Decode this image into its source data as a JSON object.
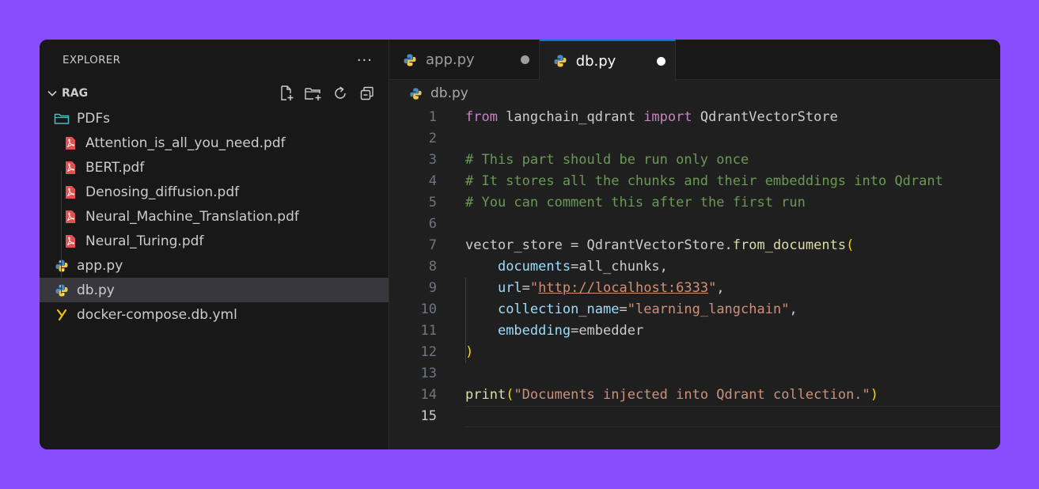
{
  "explorer": {
    "title": "EXPLORER",
    "more": "···",
    "section_title": "RAG",
    "actions": [
      "new-file-icon",
      "new-folder-icon",
      "refresh-icon",
      "collapse-all-icon"
    ],
    "folder": {
      "label": "PDFs",
      "icon": "folder-icon"
    },
    "pdf_files": [
      "Attention_is_all_you_need.pdf",
      "BERT.pdf",
      "Denosing_diffusion.pdf",
      "Neural_Machine_Translation.pdf",
      "Neural_Turing.pdf"
    ],
    "root_files": [
      {
        "label": "app.py",
        "icon": "python-icon"
      },
      {
        "label": "db.py",
        "icon": "python-icon",
        "selected": true
      },
      {
        "label": "docker-compose.db.yml",
        "icon": "yaml-icon"
      }
    ]
  },
  "tabs": [
    {
      "label": "app.py",
      "active": false,
      "unsaved": true
    },
    {
      "label": "db.py",
      "active": true,
      "unsaved": true
    }
  ],
  "breadcrumb": {
    "file": "db.py"
  },
  "colors": {
    "accent": "#0078d4",
    "background": "#8a4dfd",
    "keyword": "#c586c0",
    "comment": "#6a9955",
    "string": "#ce9178",
    "function": "#dcdcaa",
    "parameter": "#9cdcfe",
    "bracket": "#ffd700",
    "pdf_icon": "#e05252",
    "yaml_icon": "#f0c000"
  },
  "code": {
    "current_line": 15,
    "line_numbers": [
      "1",
      "2",
      "3",
      "4",
      "5",
      "6",
      "7",
      "8",
      "9",
      "10",
      "11",
      "12",
      "13",
      "14",
      "15"
    ],
    "l1": {
      "kw1": "from",
      "mod": " langchain_qdrant ",
      "kw2": "import",
      "cls": " QdrantVectorStore"
    },
    "l3": "# This part should be run only once",
    "l4": "# It stores all the chunks and their embeddings into Qdrant",
    "l5": "# You can comment this after the first run",
    "l7": {
      "var": "vector_store = QdrantVectorStore.",
      "fn": "from_documents",
      "open": "("
    },
    "l8": {
      "indent": "    ",
      "param": "documents",
      "rest": "=all_chunks,"
    },
    "l9": {
      "indent": "    ",
      "param": "url",
      "eq": "=",
      "q1": "\"",
      "url": "http://localhost:6333",
      "q2": "\"",
      "comma": ","
    },
    "l10": {
      "indent": "    ",
      "param": "collection_name",
      "eq": "=",
      "str": "\"learning_langchain\"",
      "comma": ","
    },
    "l11": {
      "indent": "    ",
      "param": "embedding",
      "rest": "=embedder"
    },
    "l12": ")",
    "l14": {
      "fn": "print",
      "open": "(",
      "str": "\"Documents injected into Qdrant collection.\"",
      "close": ")"
    }
  }
}
